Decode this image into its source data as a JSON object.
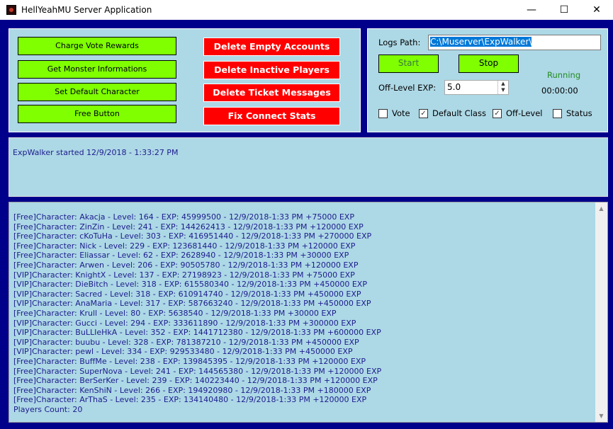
{
  "window": {
    "title": "HellYeahMU Server Application",
    "controls": [
      "minimize",
      "maximize",
      "close"
    ]
  },
  "left_panel": {
    "green_buttons": [
      "Charge Vote Rewards",
      "Get Monster Informations",
      "Set Default Character",
      "Free Button"
    ],
    "red_buttons": [
      "Delete Empty Accounts",
      "Delete Inactive Players",
      "Delete Ticket Messages",
      "Fix Connect Stats"
    ]
  },
  "right_panel": {
    "logs_path_label": "Logs Path:",
    "logs_path_value": "C:\\Muserver\\ExpWalker\\",
    "start_label": "Start",
    "stop_label": "Stop",
    "status": "Running",
    "timer": "00:00:00",
    "off_level_label": "Off-Level EXP:",
    "off_level_value": "5.0",
    "checkboxes": [
      {
        "label": "Vote",
        "checked": false
      },
      {
        "label": "Default Class",
        "checked": true
      },
      {
        "label": "Off-Level",
        "checked": true
      },
      {
        "label": "Status",
        "checked": false
      }
    ]
  },
  "log": {
    "message": "ExpWalker started 12/9/2018 - 1:33:27 PM"
  },
  "players": {
    "lines": [
      "[Free]Character: Akacja - Level: 164 - EXP: 45999500 - 12/9/2018-1:33 PM +75000 EXP",
      "[Free]Character: ZinZin - Level: 241 - EXP: 144262413 - 12/9/2018-1:33 PM +120000 EXP",
      "[Free]Character: cKoTuHa - Level: 303 - EXP: 416951440 - 12/9/2018-1:33 PM +270000 EXP",
      "[Free]Character: Nick - Level: 229 - EXP: 123681440 - 12/9/2018-1:33 PM +120000 EXP",
      "[Free]Character: Eliassar - Level: 62 - EXP: 2628940 - 12/9/2018-1:33 PM +30000 EXP",
      "[Free]Character: Arwen - Level: 206 - EXP: 90505780 - 12/9/2018-1:33 PM +120000 EXP",
      "[VIP]Character: KnightX - Level: 137 - EXP: 27198923 - 12/9/2018-1:33 PM +75000 EXP",
      "[VIP]Character: DieBitch - Level: 318 - EXP: 615580340 - 12/9/2018-1:33 PM +450000 EXP",
      "[VIP]Character: Sacred - Level: 318 - EXP: 610914740 - 12/9/2018-1:33 PM +450000 EXP",
      "[VIP]Character: AnaMaria - Level: 317 - EXP: 587663240 - 12/9/2018-1:33 PM +450000 EXP",
      "[Free]Character: Krull - Level: 80 - EXP: 5638540 - 12/9/2018-1:33 PM +30000 EXP",
      "[VIP]Character: Gucci - Level: 294 - EXP: 333611890 - 12/9/2018-1:33 PM +300000 EXP",
      "[VIP]Character: BuLLIeHkA - Level: 352 - EXP: 1441712380 - 12/9/2018-1:33 PM +600000 EXP",
      "[VIP]Character: buubu - Level: 328 - EXP: 781387210 - 12/9/2018-1:33 PM +450000 EXP",
      "[VIP]Character: pewl - Level: 334 - EXP: 929533480 - 12/9/2018-1:33 PM +450000 EXP",
      "[Free]Character: BuffMe - Level: 238 - EXP: 139845395 - 12/9/2018-1:33 PM +120000 EXP",
      "[Free]Character: SuperNova - Level: 241 - EXP: 144565380 - 12/9/2018-1:33 PM +120000 EXP",
      "[Free]Character: BerSerKer - Level: 239 - EXP: 140223440 - 12/9/2018-1:33 PM +120000 EXP",
      "[Free]Character: KenShiN - Level: 266 - EXP: 194920980 - 12/9/2018-1:33 PM +180000 EXP",
      "[Free]Character: ArThaS - Level: 235 - EXP: 134140480 - 12/9/2018-1:33 PM +120000 EXP",
      "Players Count: 20"
    ]
  },
  "colors": {
    "background": "#00008b",
    "panel": "#add8e6",
    "green_button": "#7fff00",
    "red_button": "#ff0000",
    "status_running": "#228b22",
    "log_text": "#1c1c8c"
  }
}
